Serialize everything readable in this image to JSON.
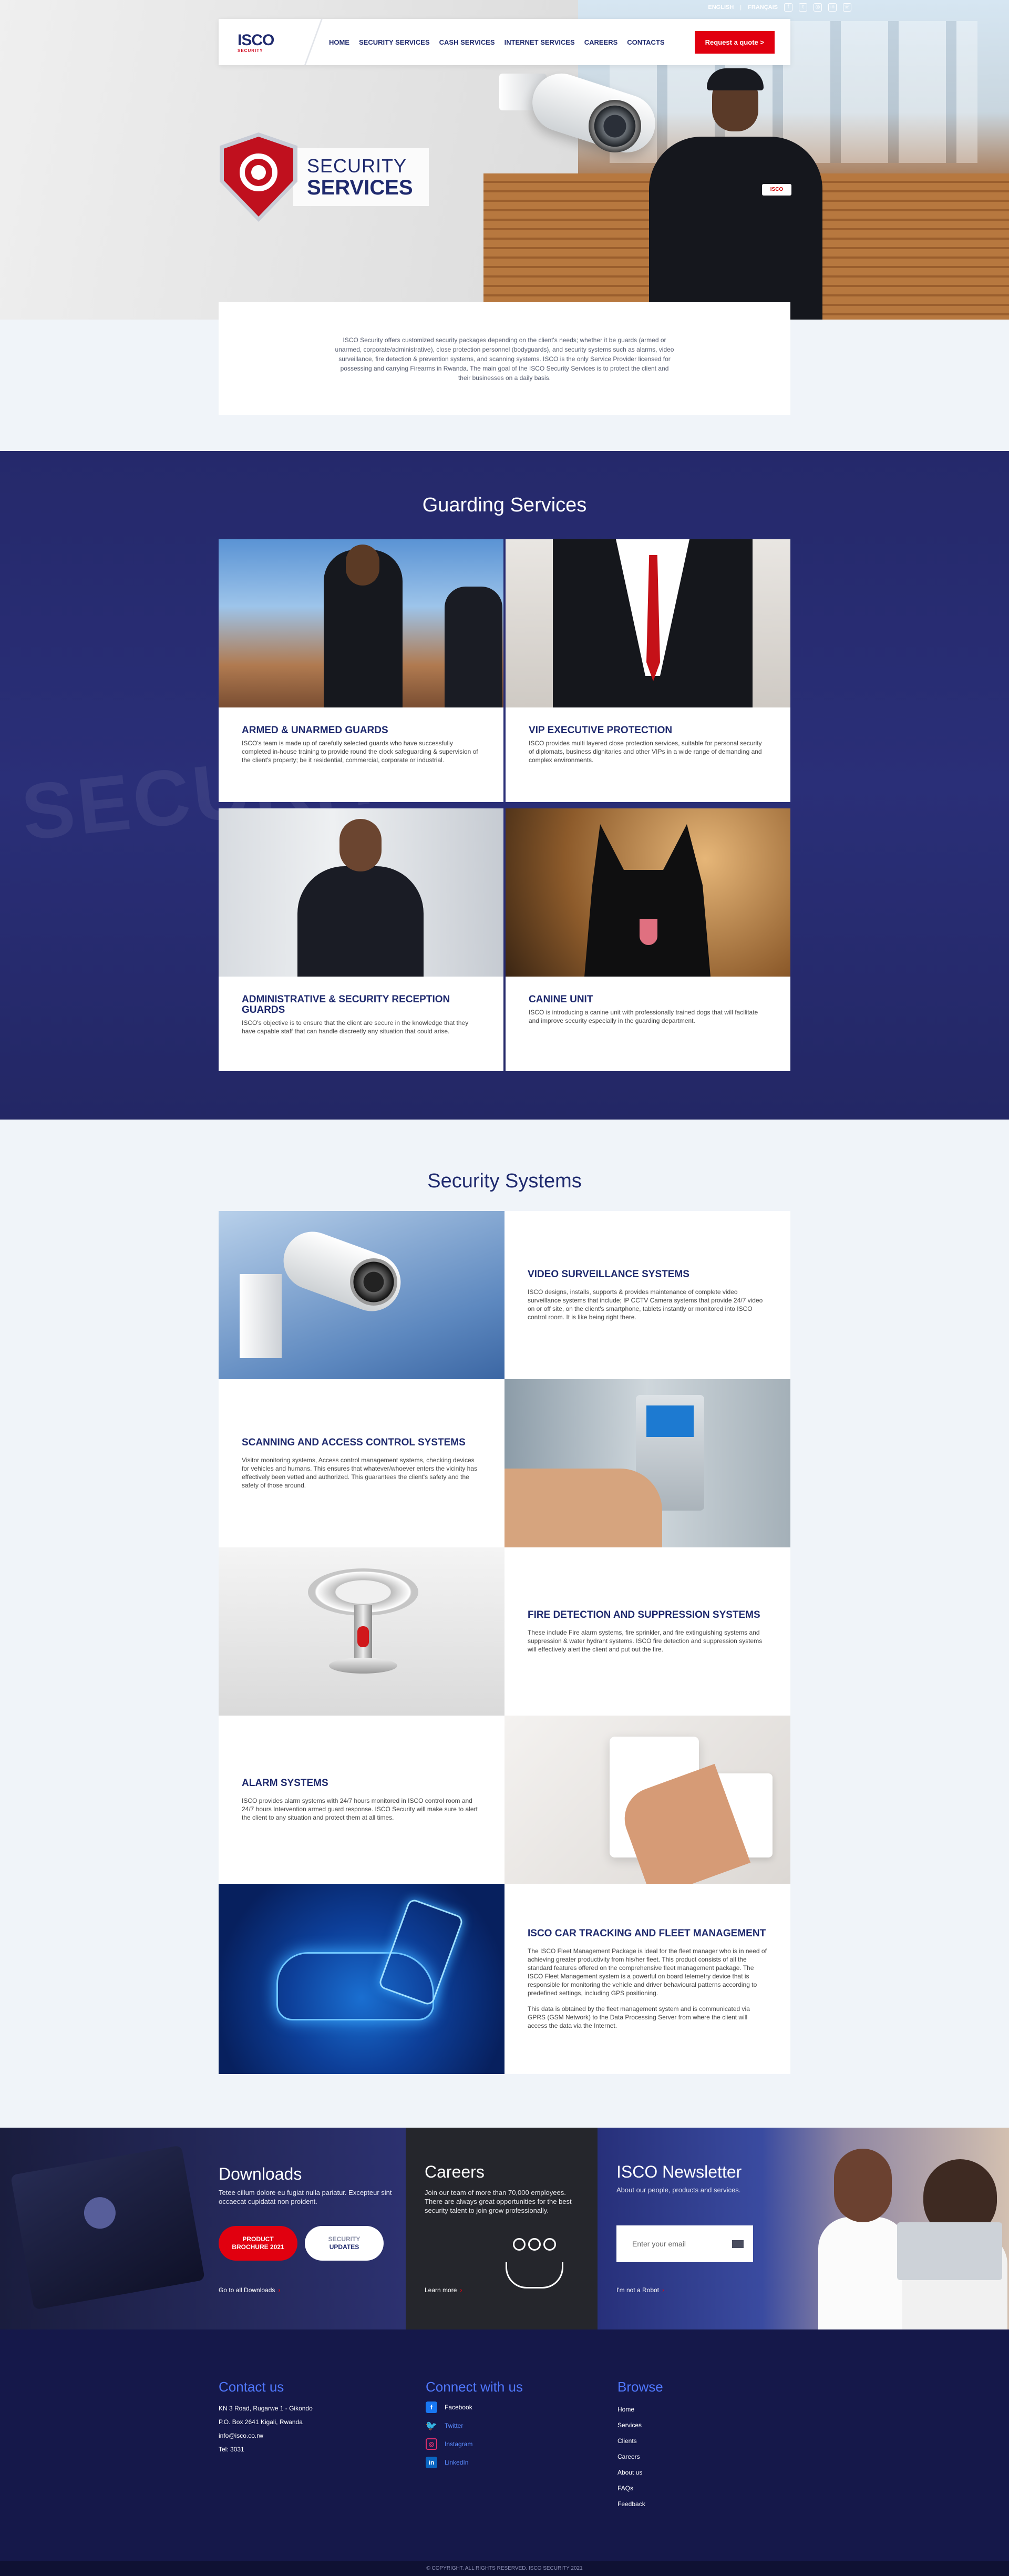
{
  "topbar": {
    "langs": [
      "ENGLISH",
      "FRANÇAIS"
    ],
    "lang_sep": "|",
    "social": [
      "facebook-icon",
      "twitter-icon",
      "instagram-icon",
      "linkedin-icon",
      "phone-icon"
    ]
  },
  "nav": {
    "logo": "ISCO",
    "logo_sub": "SECURITY",
    "items": [
      "HOME",
      "SECURITY SERVICES",
      "CASH SERVICES",
      "INTERNET SERVICES",
      "CAREERS",
      "CONTACTS"
    ],
    "quote": "Request a quote >"
  },
  "hero": {
    "title_l1": "SECURITY",
    "title_l2": "SERVICES",
    "intro": "ISCO Security offers customized security packages depending on the client's needs; whether it be guards (armed or unarmed, corporate/administrative), close protection personnel (bodyguards), and security systems such as alarms, video surveillance, fire detection & prevention systems, and scanning systems. ISCO is the only Service Provider licensed for possessing and carrying Firearms in Rwanda. The main goal of the ISCO Security Services is to protect the client and their businesses on a daily basis."
  },
  "guarding": {
    "title": "Guarding Services",
    "cards": [
      {
        "title": "ARMED & UNARMED GUARDS",
        "text": "ISCO's team is made up of carefully selected guards who have successfully completed in-house training to provide round the clock safeguarding & supervision of the client's property; be it residential, commercial, corporate or industrial."
      },
      {
        "title": "VIP EXECUTIVE PROTECTION",
        "text": "ISCO provides multi layered close protection services, suitable for personal security of diplomats, business dignitaries and other VIPs in a wide range of demanding and complex environments."
      },
      {
        "title": "ADMINISTRATIVE & SECURITY RECEPTION GUARDS",
        "text": "ISCO's objective is to ensure that the client are secure in the knowledge that they have capable staff that can handle discreetly any situation that could arise."
      },
      {
        "title": "CANINE UNIT",
        "text": "ISCO is introducing a canine unit with professionally trained dogs that will facilitate and improve security especially in the guarding department."
      }
    ]
  },
  "systems": {
    "title": "Security Systems",
    "items": [
      {
        "title": "VIDEO SURVEILLANCE SYSTEMS",
        "text": "ISCO designs, installs, supports & provides maintenance of complete video surveillance systems that include; IP CCTV Camera systems that provide 24/7 video on or off site, on the client's smartphone, tablets instantly or monitored into ISCO control room. It is like being right there."
      },
      {
        "title": "SCANNING AND ACCESS CONTROL SYSTEMS",
        "text": "Visitor monitoring systems, Access control management systems, checking devices for vehicles and humans. This ensures that whatever/whoever enters the vicinity has effectively been vetted and authorized. This guarantees the client's safety and the safety of those around."
      },
      {
        "title": "FIRE DETECTION AND SUPPRESSION SYSTEMS",
        "text": "These include Fire alarm systems, fire sprinkler, and fire extinguishing systems and suppression & water hydrant systems. ISCO fire detection and suppression systems will effectively alert the client and put out the fire."
      },
      {
        "title": "ALARM SYSTEMS",
        "text": "ISCO provides alarm systems with 24/7 hours monitored in ISCO control room and 24/7 hours Intervention armed guard response. ISCO Security will make sure to alert the client to any situation and protect them at all times."
      },
      {
        "title": "ISCO CAR TRACKING AND FLEET MANAGEMENT",
        "text": "The ISCO Fleet Management Package is ideal for the fleet manager who is in need of achieving greater productivity from his/her fleet. This product consists of all the standard features offered on the comprehensive fleet management package. The ISCO Fleet Management system is a powerful on board telemetry device that is responsible for monitoring the vehicle and driver behavioural patterns according to predefined settings, including GPS positioning.",
        "text2": "This data is obtained by the fleet management system and is communicated via GPRS (GSM Network) to the Data Processing Server from where the client will access the data via the Internet."
      }
    ]
  },
  "downloads": {
    "title": "Downloads",
    "text": "Tetee cillum dolore eu fugiat nulla pariatur. Excepteur sint occaecat cupidatat non proident.",
    "btn1_l1": "PRODUCT",
    "btn1_l2": "BROCHURE 2021",
    "btn2_l1": "SECURITY",
    "btn2_l2": "UPDATES",
    "link": "Go to all Downloads"
  },
  "careers": {
    "title": "Careers",
    "text": "Join our team of more than 70,000 employees. There are always great opportunities for the best security talent to join grow professionally.",
    "link": "Learn more"
  },
  "newsletter": {
    "title": "ISCO Newsletter",
    "text": "About our people, products and services.",
    "placeholder": "Enter your email",
    "robot": "I'm not a Robot"
  },
  "footer": {
    "contact_title": "Contact us",
    "contact": [
      "KN 3 Road, Rugarwe 1 - Gikondo",
      "P.O. Box 2641 Kigali, Rwanda",
      "info@isco.co.rw",
      "Tel: 3031"
    ],
    "connect_title": "Connect with us",
    "social": [
      "Facebook",
      "Twitter",
      "Instagram",
      "LinkedIn"
    ],
    "browse_title": "Browse",
    "browse": [
      "Home",
      "Services",
      "Clients",
      "Careers",
      "About us",
      "FAQs",
      "Feedback"
    ],
    "copyright": "© COPYRIGHT. ALL RIGHTS RESERVED. ISCO SECURITY 2021"
  },
  "colors": {
    "navy": "#1f2a6e",
    "red": "#e1000f",
    "band": "#2a2f78"
  }
}
